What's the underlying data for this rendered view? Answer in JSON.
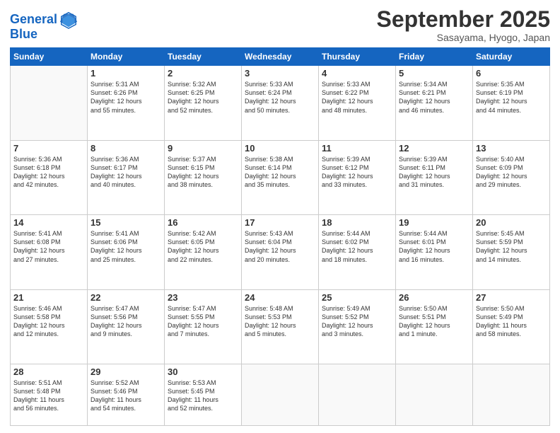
{
  "logo": {
    "line1": "General",
    "line2": "Blue"
  },
  "title": "September 2025",
  "location": "Sasayama, Hyogo, Japan",
  "weekdays": [
    "Sunday",
    "Monday",
    "Tuesday",
    "Wednesday",
    "Thursday",
    "Friday",
    "Saturday"
  ],
  "weeks": [
    [
      {
        "day": "",
        "info": ""
      },
      {
        "day": "1",
        "info": "Sunrise: 5:31 AM\nSunset: 6:26 PM\nDaylight: 12 hours\nand 55 minutes."
      },
      {
        "day": "2",
        "info": "Sunrise: 5:32 AM\nSunset: 6:25 PM\nDaylight: 12 hours\nand 52 minutes."
      },
      {
        "day": "3",
        "info": "Sunrise: 5:33 AM\nSunset: 6:24 PM\nDaylight: 12 hours\nand 50 minutes."
      },
      {
        "day": "4",
        "info": "Sunrise: 5:33 AM\nSunset: 6:22 PM\nDaylight: 12 hours\nand 48 minutes."
      },
      {
        "day": "5",
        "info": "Sunrise: 5:34 AM\nSunset: 6:21 PM\nDaylight: 12 hours\nand 46 minutes."
      },
      {
        "day": "6",
        "info": "Sunrise: 5:35 AM\nSunset: 6:19 PM\nDaylight: 12 hours\nand 44 minutes."
      }
    ],
    [
      {
        "day": "7",
        "info": "Sunrise: 5:36 AM\nSunset: 6:18 PM\nDaylight: 12 hours\nand 42 minutes."
      },
      {
        "day": "8",
        "info": "Sunrise: 5:36 AM\nSunset: 6:17 PM\nDaylight: 12 hours\nand 40 minutes."
      },
      {
        "day": "9",
        "info": "Sunrise: 5:37 AM\nSunset: 6:15 PM\nDaylight: 12 hours\nand 38 minutes."
      },
      {
        "day": "10",
        "info": "Sunrise: 5:38 AM\nSunset: 6:14 PM\nDaylight: 12 hours\nand 35 minutes."
      },
      {
        "day": "11",
        "info": "Sunrise: 5:39 AM\nSunset: 6:12 PM\nDaylight: 12 hours\nand 33 minutes."
      },
      {
        "day": "12",
        "info": "Sunrise: 5:39 AM\nSunset: 6:11 PM\nDaylight: 12 hours\nand 31 minutes."
      },
      {
        "day": "13",
        "info": "Sunrise: 5:40 AM\nSunset: 6:09 PM\nDaylight: 12 hours\nand 29 minutes."
      }
    ],
    [
      {
        "day": "14",
        "info": "Sunrise: 5:41 AM\nSunset: 6:08 PM\nDaylight: 12 hours\nand 27 minutes."
      },
      {
        "day": "15",
        "info": "Sunrise: 5:41 AM\nSunset: 6:06 PM\nDaylight: 12 hours\nand 25 minutes."
      },
      {
        "day": "16",
        "info": "Sunrise: 5:42 AM\nSunset: 6:05 PM\nDaylight: 12 hours\nand 22 minutes."
      },
      {
        "day": "17",
        "info": "Sunrise: 5:43 AM\nSunset: 6:04 PM\nDaylight: 12 hours\nand 20 minutes."
      },
      {
        "day": "18",
        "info": "Sunrise: 5:44 AM\nSunset: 6:02 PM\nDaylight: 12 hours\nand 18 minutes."
      },
      {
        "day": "19",
        "info": "Sunrise: 5:44 AM\nSunset: 6:01 PM\nDaylight: 12 hours\nand 16 minutes."
      },
      {
        "day": "20",
        "info": "Sunrise: 5:45 AM\nSunset: 5:59 PM\nDaylight: 12 hours\nand 14 minutes."
      }
    ],
    [
      {
        "day": "21",
        "info": "Sunrise: 5:46 AM\nSunset: 5:58 PM\nDaylight: 12 hours\nand 12 minutes."
      },
      {
        "day": "22",
        "info": "Sunrise: 5:47 AM\nSunset: 5:56 PM\nDaylight: 12 hours\nand 9 minutes."
      },
      {
        "day": "23",
        "info": "Sunrise: 5:47 AM\nSunset: 5:55 PM\nDaylight: 12 hours\nand 7 minutes."
      },
      {
        "day": "24",
        "info": "Sunrise: 5:48 AM\nSunset: 5:53 PM\nDaylight: 12 hours\nand 5 minutes."
      },
      {
        "day": "25",
        "info": "Sunrise: 5:49 AM\nSunset: 5:52 PM\nDaylight: 12 hours\nand 3 minutes."
      },
      {
        "day": "26",
        "info": "Sunrise: 5:50 AM\nSunset: 5:51 PM\nDaylight: 12 hours\nand 1 minute."
      },
      {
        "day": "27",
        "info": "Sunrise: 5:50 AM\nSunset: 5:49 PM\nDaylight: 11 hours\nand 58 minutes."
      }
    ],
    [
      {
        "day": "28",
        "info": "Sunrise: 5:51 AM\nSunset: 5:48 PM\nDaylight: 11 hours\nand 56 minutes."
      },
      {
        "day": "29",
        "info": "Sunrise: 5:52 AM\nSunset: 5:46 PM\nDaylight: 11 hours\nand 54 minutes."
      },
      {
        "day": "30",
        "info": "Sunrise: 5:53 AM\nSunset: 5:45 PM\nDaylight: 11 hours\nand 52 minutes."
      },
      {
        "day": "",
        "info": ""
      },
      {
        "day": "",
        "info": ""
      },
      {
        "day": "",
        "info": ""
      },
      {
        "day": "",
        "info": ""
      }
    ]
  ]
}
